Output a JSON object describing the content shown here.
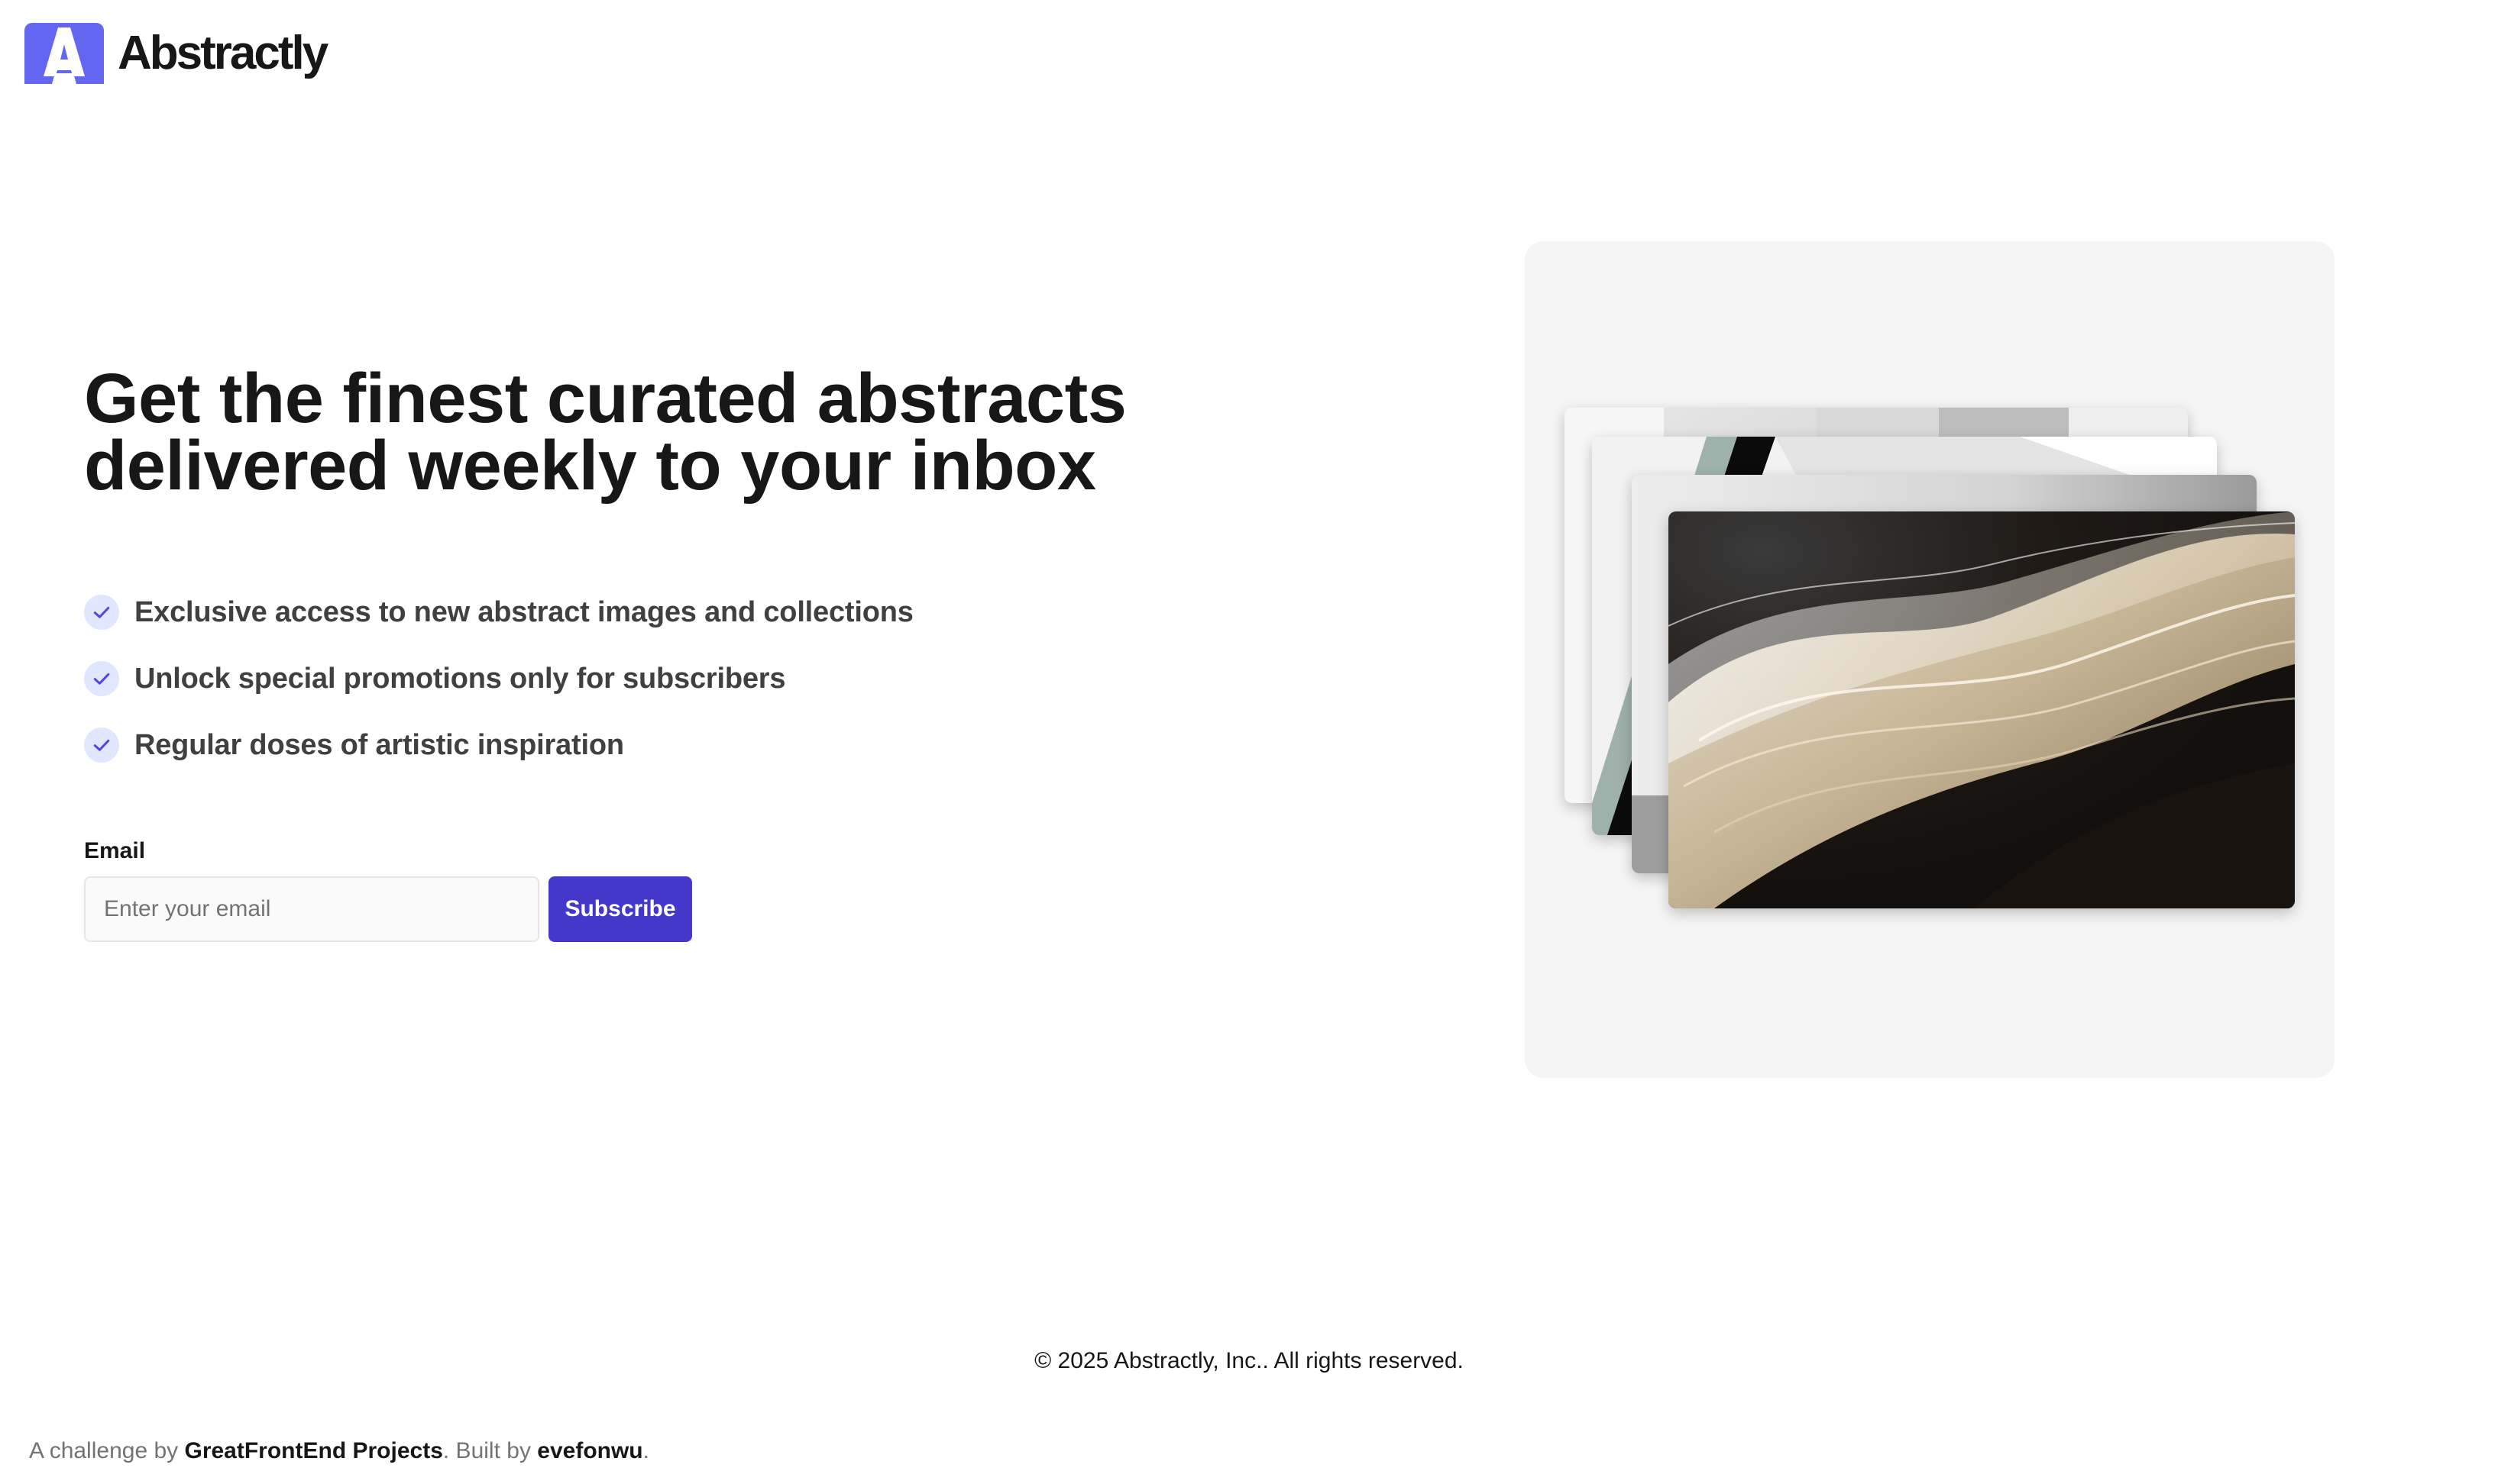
{
  "brand": {
    "name": "Abstractly",
    "logo_icon": "abstractly-logo-icon",
    "accent_color": "#6366f1"
  },
  "hero": {
    "title": "Get the finest curated abstracts delivered weekly to your inbox",
    "features": [
      {
        "icon": "check-icon",
        "text": "Exclusive access to new abstract images and collections"
      },
      {
        "icon": "check-icon",
        "text": "Unlock special promotions only for subscribers"
      },
      {
        "icon": "check-icon",
        "text": "Regular doses of artistic inspiration"
      }
    ]
  },
  "form": {
    "email_label": "Email",
    "email_placeholder": "Enter your email",
    "email_value": "",
    "subscribe_label": "Subscribe",
    "button_color": "#4338ca"
  },
  "gallery": {
    "images": [
      "abstract-photo-1",
      "abstract-photo-2",
      "abstract-photo-3",
      "abstract-photo-4"
    ]
  },
  "footer": {
    "copyright": "© 2025 Abstractly, Inc.. All rights reserved."
  },
  "credit": {
    "prefix": "A challenge by ",
    "challenge_link": "GreatFrontEnd Projects",
    "middle": ". Built by ",
    "author_link": "evefonwu",
    "suffix": "."
  }
}
